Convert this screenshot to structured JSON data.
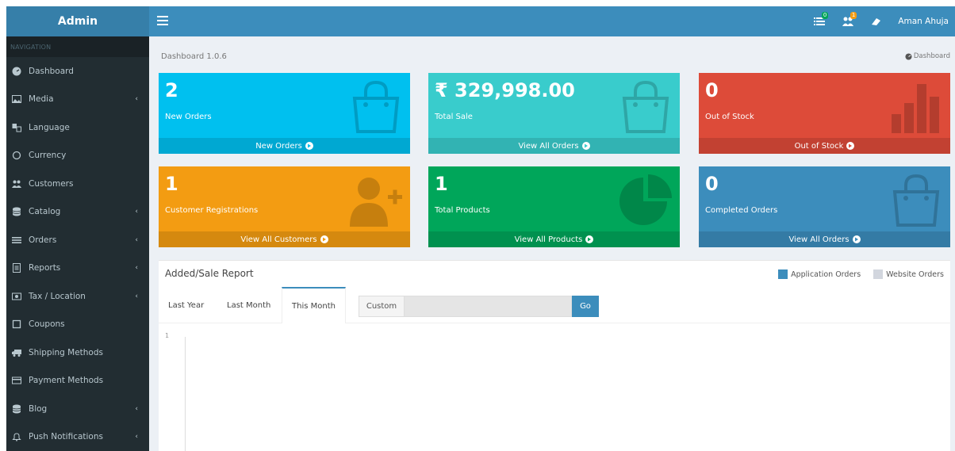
{
  "sidebar": {
    "logo": "Admin",
    "nav_header": "NAVIGATION",
    "items": [
      {
        "label": "Dashboard",
        "icon": "dashboard-icon",
        "chevron": false
      },
      {
        "label": "Media",
        "icon": "image-icon",
        "chevron": true
      },
      {
        "label": "Language",
        "icon": "language-icon",
        "chevron": false
      },
      {
        "label": "Currency",
        "icon": "circle-icon",
        "chevron": false
      },
      {
        "label": "Customers",
        "icon": "users-icon",
        "chevron": false
      },
      {
        "label": "Catalog",
        "icon": "database-icon",
        "chevron": true
      },
      {
        "label": "Orders",
        "icon": "list-icon",
        "chevron": true
      },
      {
        "label": "Reports",
        "icon": "file-icon",
        "chevron": true
      },
      {
        "label": "Tax / Location",
        "icon": "map-marker-icon",
        "chevron": true
      },
      {
        "label": "Coupons",
        "icon": "square-icon",
        "chevron": false
      },
      {
        "label": "Shipping Methods",
        "icon": "truck-icon",
        "chevron": false
      },
      {
        "label": "Payment Methods",
        "icon": "credit-card-icon",
        "chevron": false
      },
      {
        "label": "Blog",
        "icon": "database-icon",
        "chevron": true
      },
      {
        "label": "Push Notifications",
        "icon": "bell-icon",
        "chevron": true
      }
    ]
  },
  "topbar": {
    "user_name": "Aman Ahuja",
    "orders_badge": "0",
    "customers_badge": "1"
  },
  "content": {
    "title": "Dashboard 1.0.6",
    "breadcrumb": "Dashboard"
  },
  "stats": [
    {
      "value": "2",
      "label": "New Orders",
      "footer": "New Orders",
      "color": "#00c0ef",
      "icon": "shopping-bag-icon"
    },
    {
      "value": "₹ 329,998.00",
      "label": "Total Sale",
      "footer": "View All Orders",
      "color": "#39cccc",
      "icon": "shopping-bag-icon"
    },
    {
      "value": "0",
      "label": "Out of Stock",
      "footer": "Out of Stock",
      "color": "#dd4b39",
      "icon": "bar-chart-icon"
    },
    {
      "value": "1",
      "label": "Customer Registrations",
      "footer": "View All Customers",
      "color": "#f39c12",
      "icon": "user-plus-icon"
    },
    {
      "value": "1",
      "label": "Total Products",
      "footer": "View All Products",
      "color": "#00a65a",
      "icon": "pie-chart-icon"
    },
    {
      "value": "0",
      "label": "Completed Orders",
      "footer": "View All Orders",
      "color": "#3c8dbc",
      "icon": "shopping-bag-icon"
    }
  ],
  "report": {
    "title": "Added/Sale Report",
    "legend": [
      {
        "label": "Application Orders",
        "color": "#3c8dbc"
      },
      {
        "label": "Website Orders",
        "color": "#d2d6de"
      }
    ],
    "tabs": [
      "Last Year",
      "Last Month",
      "This Month"
    ],
    "active_tab": "This Month",
    "custom_label": "Custom",
    "custom_value": "",
    "go_label": "Go",
    "y_tick": "1"
  }
}
